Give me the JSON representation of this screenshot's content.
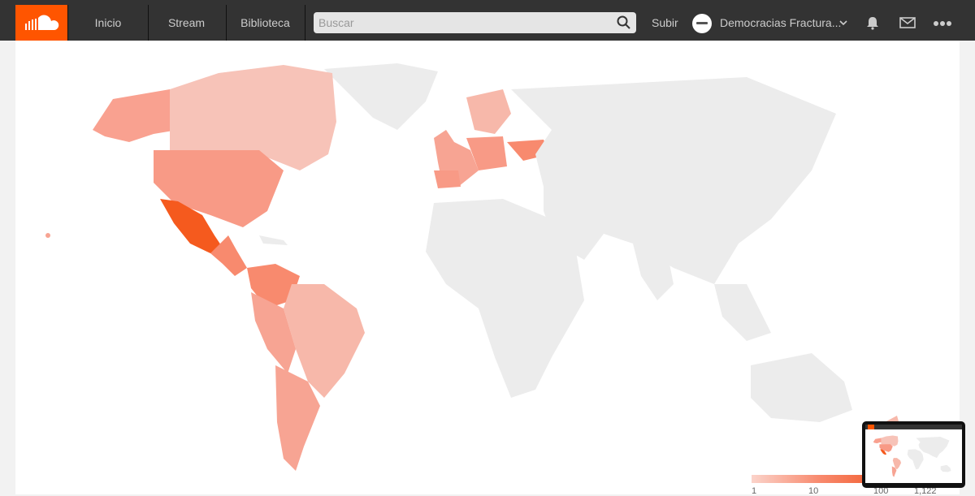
{
  "header": {
    "logo": "soundcloud-logo",
    "nav": [
      "Inicio",
      "Stream",
      "Biblioteca"
    ],
    "search_placeholder": "Buscar",
    "upload_label": "Subir",
    "username": "Democracias Fractura..."
  },
  "icons": {
    "search": "magnifier",
    "notifications": "bell",
    "messages": "envelope",
    "more": "three-dots",
    "user_menu": "chevron-down"
  },
  "map": {
    "type": "choropleth",
    "colors": {
      "low": "#fbd3ca",
      "mid": "#f88a6e",
      "high": "#f50",
      "no_data": "#ececec"
    },
    "shaded_regions": [
      {
        "region": "Alaska",
        "level": "mid"
      },
      {
        "region": "Canada",
        "level": "low"
      },
      {
        "region": "United States",
        "level": "mid"
      },
      {
        "region": "Mexico",
        "level": "high"
      },
      {
        "region": "Central America",
        "level": "mid"
      },
      {
        "region": "Colombia / Venezuela",
        "level": "mid"
      },
      {
        "region": "Brazil",
        "level": "low"
      },
      {
        "region": "Peru / Bolivia",
        "level": "mid"
      },
      {
        "region": "Chile",
        "level": "mid"
      },
      {
        "region": "Argentina",
        "level": "low"
      },
      {
        "region": "Ireland / UK",
        "level": "mid"
      },
      {
        "region": "France / Spain / Portugal",
        "level": "mid"
      },
      {
        "region": "Germany / Central Europe",
        "level": "mid"
      },
      {
        "region": "Scandinavia",
        "level": "mid"
      },
      {
        "region": "Ukraine",
        "level": "mid"
      }
    ]
  },
  "legend": {
    "labels": [
      "1",
      "10",
      "100",
      "1,122"
    ]
  }
}
